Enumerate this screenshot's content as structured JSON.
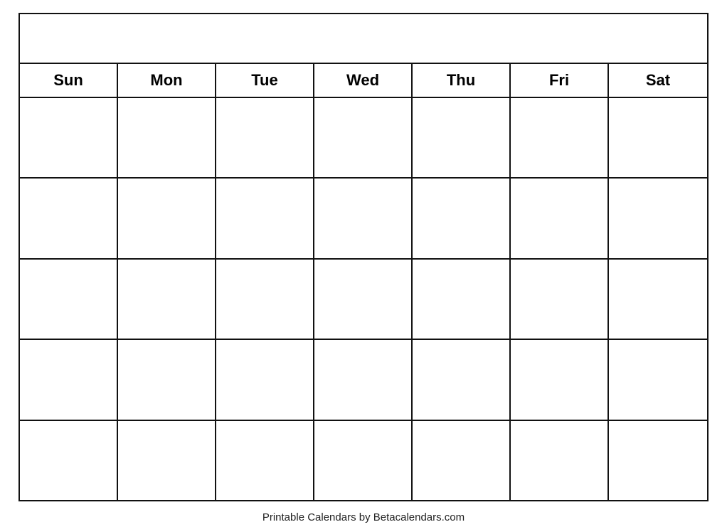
{
  "calendar": {
    "title": "",
    "days": [
      "Sun",
      "Mon",
      "Tue",
      "Wed",
      "Thu",
      "Fri",
      "Sat"
    ],
    "weeks": 5
  },
  "footer": {
    "text": "Printable Calendars by Betacalendars.com"
  }
}
